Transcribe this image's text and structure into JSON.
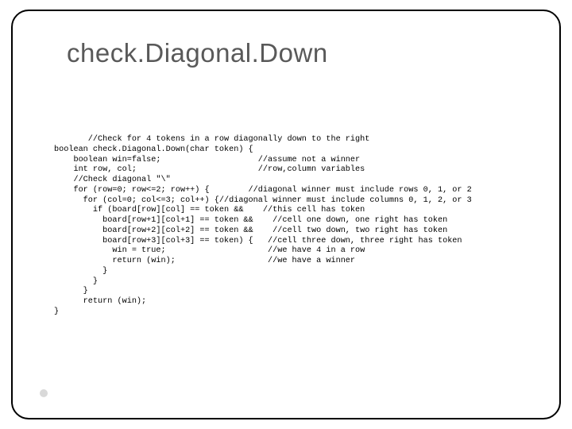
{
  "title": "check.Diagonal.Down",
  "code": {
    "l01": "       //Check for 4 tokens in a row diagonally down to the right",
    "l02": "boolean check.Diagonal.Down(char token) {",
    "l03": "    boolean win=false;                    //assume not a winner",
    "l04": "    int row, col;                         //row,column variables",
    "l05": "    //Check diagonal \"\\\"",
    "l06": "    for (row=0; row<=2; row++) {        //diagonal winner must include rows 0, 1, or 2",
    "l07": "      for (col=0; col<=3; col++) {//diagonal winner must include columns 0, 1, 2, or 3",
    "l08": "        if (board[row][col] == token &&    //this cell has token",
    "l09": "          board[row+1][col+1] == token &&    //cell one down, one right has token",
    "l10": "          board[row+2][col+2] == token &&    //cell two down, two right has token",
    "l11": "          board[row+3][col+3] == token) {   //cell three down, three right has token",
    "l12": "            win = true;                     //we have 4 in a row",
    "l13": "            return (win);                   //we have a winner",
    "l14": "          }",
    "l15": "        }",
    "l16": "      }",
    "l17": "      return (win);",
    "l18": "}"
  }
}
